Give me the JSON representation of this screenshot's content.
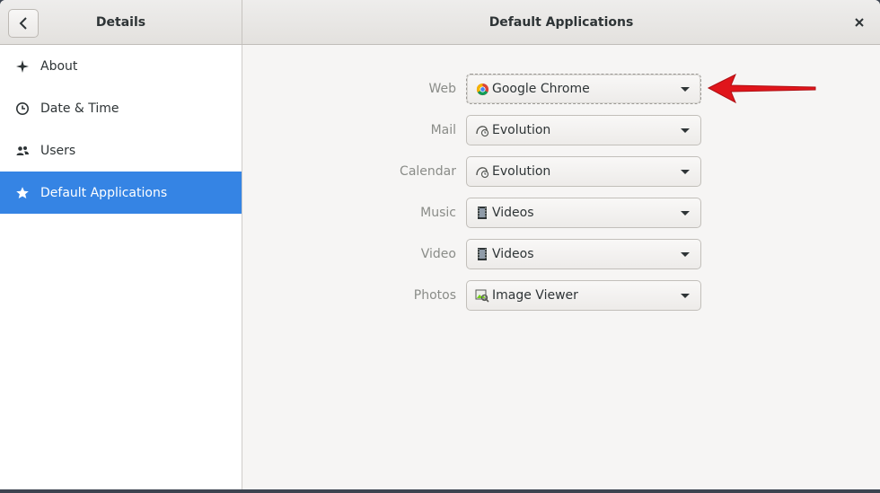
{
  "header": {
    "sidebar_title": "Details",
    "main_title": "Default Applications"
  },
  "sidebar": {
    "items": [
      {
        "label": "About",
        "icon": "sparkle-icon"
      },
      {
        "label": "Date & Time",
        "icon": "clock-icon"
      },
      {
        "label": "Users",
        "icon": "users-icon"
      },
      {
        "label": "Default Applications",
        "icon": "star-icon",
        "selected": true
      }
    ]
  },
  "defaults": [
    {
      "label": "Web",
      "app": "Google Chrome",
      "icon": "chrome-icon"
    },
    {
      "label": "Mail",
      "app": "Evolution",
      "icon": "evolution-icon"
    },
    {
      "label": "Calendar",
      "app": "Evolution",
      "icon": "evolution-icon"
    },
    {
      "label": "Music",
      "app": "Videos",
      "icon": "videos-icon"
    },
    {
      "label": "Video",
      "app": "Videos",
      "icon": "videos-icon"
    },
    {
      "label": "Photos",
      "app": "Image Viewer",
      "icon": "image-viewer-icon"
    }
  ],
  "colors": {
    "accent": "#3584e4",
    "annotation_arrow": "#e0151b"
  }
}
